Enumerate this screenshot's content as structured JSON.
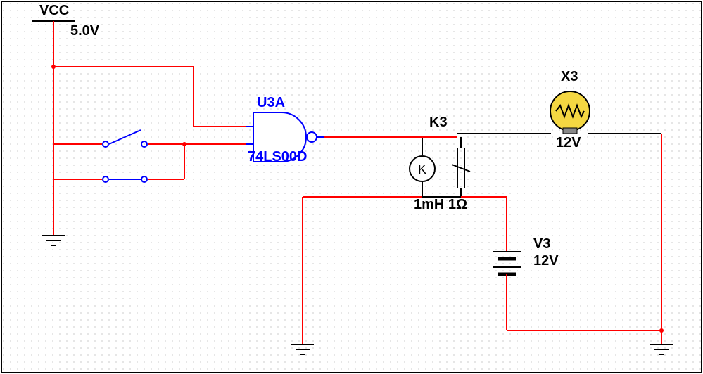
{
  "supply": {
    "name": "VCC",
    "value": "5.0V"
  },
  "gate": {
    "refdes": "U3A",
    "part": "74LS00D"
  },
  "relay": {
    "refdes": "K3",
    "value": "1mH 1Ω"
  },
  "lamp": {
    "refdes": "X3",
    "value": "12V"
  },
  "source": {
    "refdes": "V3",
    "value": "12V"
  }
}
